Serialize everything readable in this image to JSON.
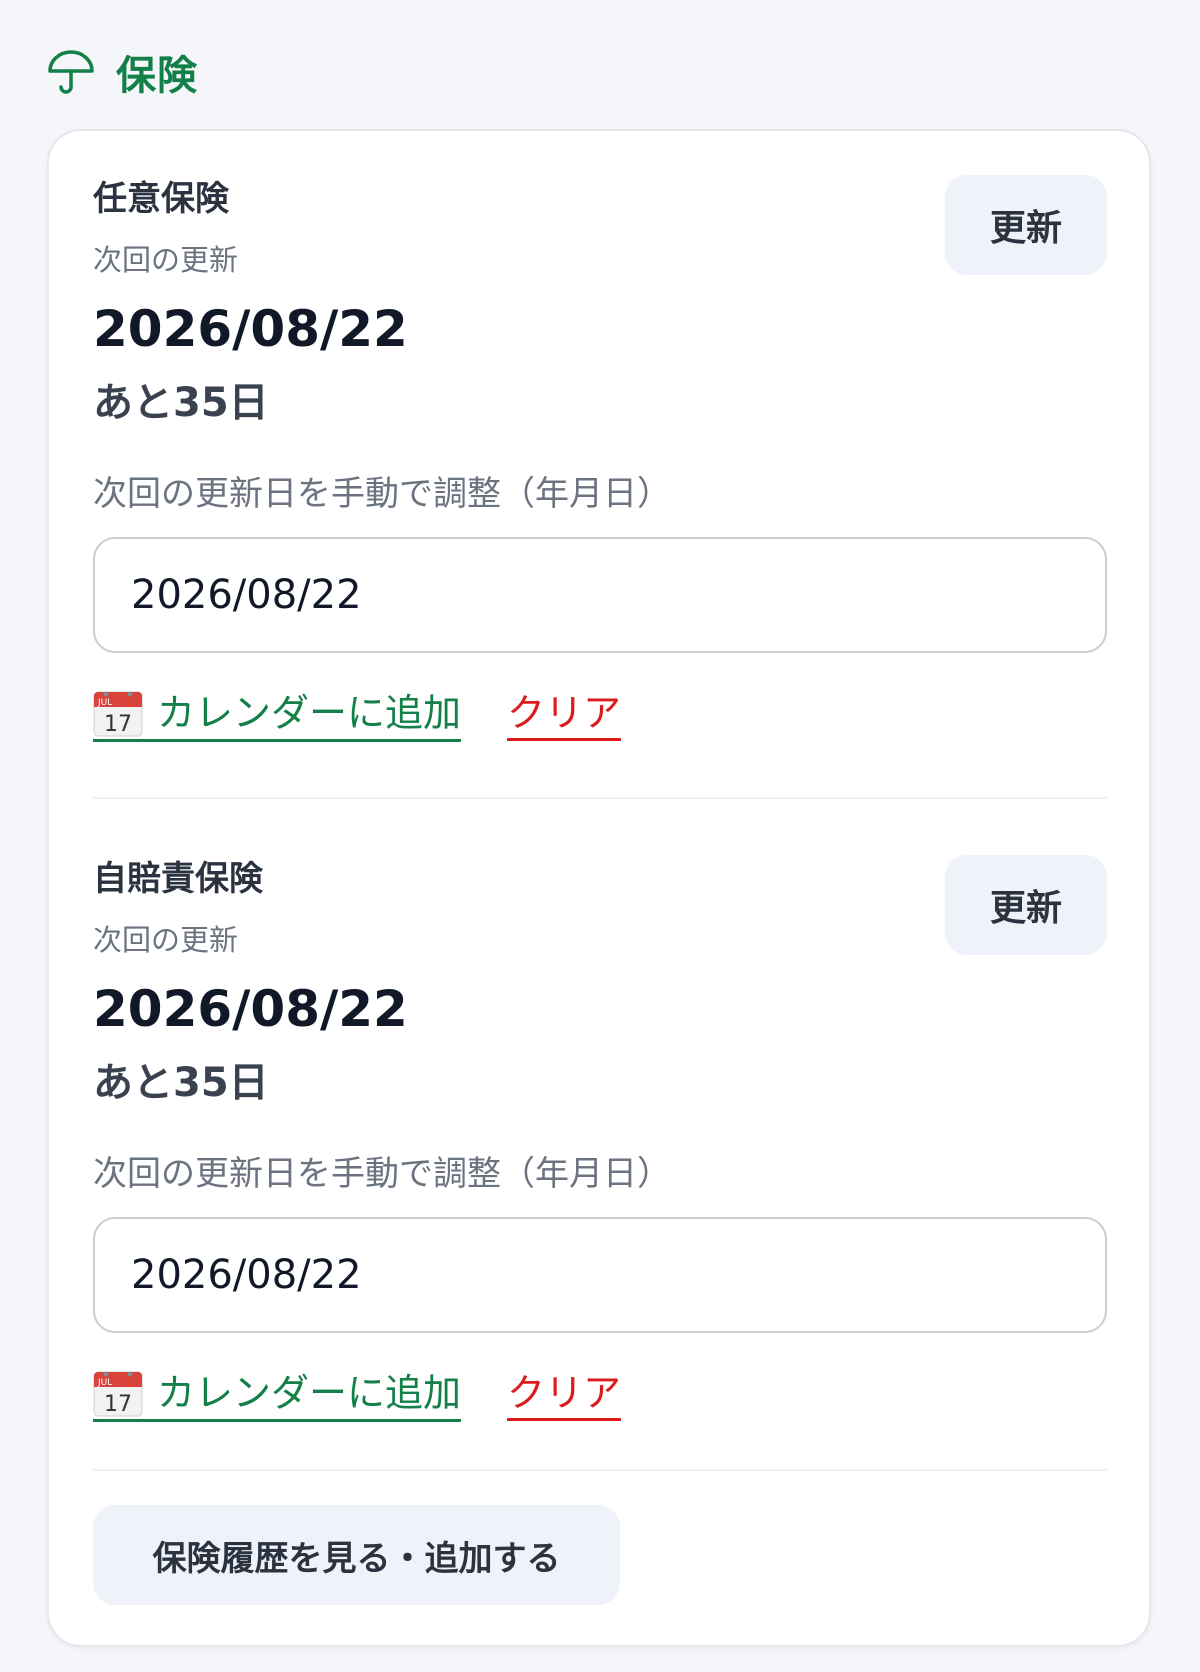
{
  "section": {
    "title": "保険",
    "icon": "umbrella-icon",
    "accent_color": "#128048"
  },
  "insurances": [
    {
      "title": "任意保険",
      "subtitle": "次回の更新",
      "date": "2026/08/22",
      "remaining": "あと35日",
      "update_label": "更新",
      "adjust_label": "次回の更新日を手動で調整（年月日）",
      "input_value": "2026/08/22",
      "calendar_icon_month": "JUL",
      "calendar_icon_day": "17",
      "calendar_link": "カレンダーに追加",
      "clear_link": "クリア"
    },
    {
      "title": "自賠責保険",
      "subtitle": "次回の更新",
      "date": "2026/08/22",
      "remaining": "あと35日",
      "update_label": "更新",
      "adjust_label": "次回の更新日を手動で調整（年月日）",
      "input_value": "2026/08/22",
      "calendar_icon_month": "JUL",
      "calendar_icon_day": "17",
      "calendar_link": "カレンダーに追加",
      "clear_link": "クリア"
    }
  ],
  "history_button": "保険履歴を見る・追加する",
  "colors": {
    "link_green": "#128048",
    "clear_red": "#dc1c1c",
    "button_bg": "#eff2f8"
  }
}
